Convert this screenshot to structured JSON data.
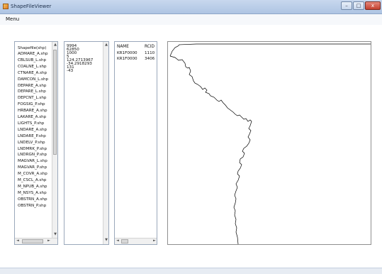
{
  "window": {
    "title": "ShapeFileViewer",
    "minimize_glyph": "–",
    "maximize_glyph": "□",
    "close_glyph": "x"
  },
  "menu": {
    "label": "Menu"
  },
  "file_list": {
    "header": "Shapefile(shp)",
    "items": [
      "ADMARE_A.shp",
      "CBLSUB_L.shp",
      "COALNE_L.shp",
      "CTNARE_A.shp",
      "DAMCON_L.shp",
      "DEPARE_A.shp",
      "DEPARE_L.shp",
      "DEPCNT_L.shp",
      "FOGSIG_P.shp",
      "HRBARE_A.shp",
      "LAKARE_A.shp",
      "LIGHTS_P.shp",
      "LNDARE_A.shp",
      "LNDARE_P.shp",
      "LNDELV_P.shp",
      "LNDMRK_P.shp",
      "LNDRGN_P.shp",
      "MAGVAR_L.shp",
      "MAGVAR_P.shp",
      "M_COVR_A.shp",
      "M_CSCL_A.shp",
      "M_NPUB_A.shp",
      "M_NSYS_A.shp",
      "OBSTRN_A.shp",
      "OBSTRN_P.shp"
    ]
  },
  "info_panel": {
    "lines": [
      "9994",
      "62850",
      "1000",
      "5",
      "124.2713967",
      "-34.2918293",
      "131",
      "-43"
    ]
  },
  "attr_table": {
    "columns": [
      "NAME",
      "RCID"
    ],
    "rows": [
      {
        "name": "KR1F0000",
        "rcid": "1110"
      },
      {
        "name": "KR1F0000",
        "rcid": "3406"
      }
    ]
  },
  "icons": {
    "scroll_up": "up-arrow-icon",
    "scroll_down": "down-arrow-icon",
    "scroll_left": "left-arrow-icon",
    "scroll_right": "right-arrow-icon"
  },
  "colors": {
    "titlebar": "#b9cde8",
    "map_line": "#000000",
    "close_button": "#c8463a"
  }
}
